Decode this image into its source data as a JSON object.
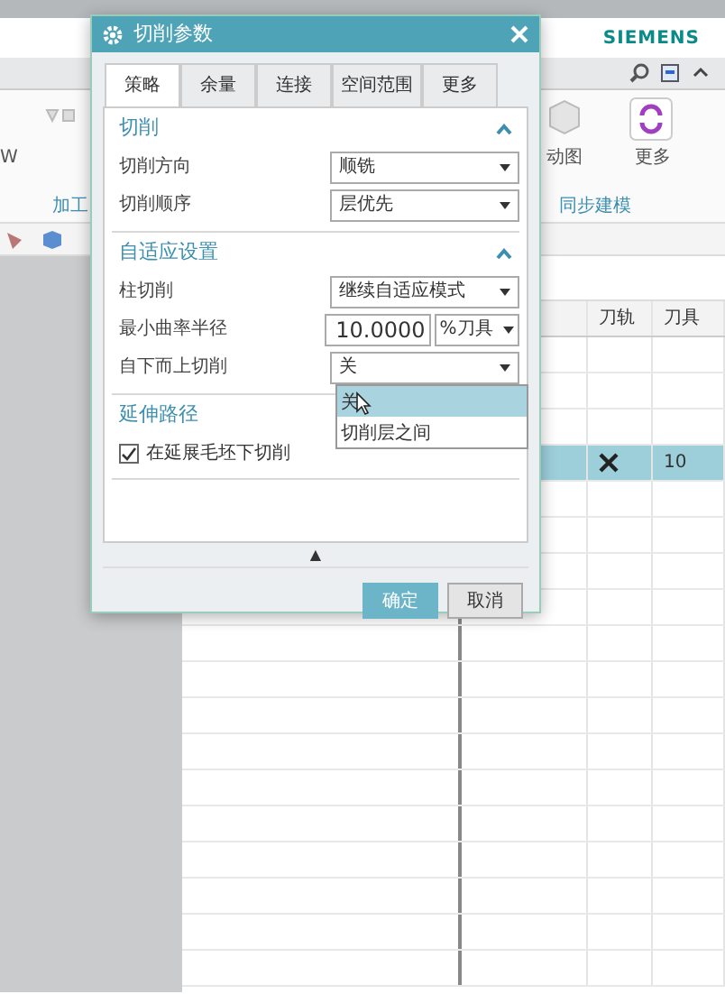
{
  "app": {
    "brand": "SIEMENS",
    "ribbon_labels": [
      {
        "text": "W"
      },
      {
        "text": "加工"
      },
      {
        "text": "动图"
      },
      {
        "text": "更多"
      },
      {
        "text": "同步建模"
      }
    ]
  },
  "table": {
    "columns": [
      "刀轨",
      "刀具"
    ],
    "rows": [
      {
        "selected": false
      },
      {
        "selected": false
      },
      {
        "selected": false
      },
      {
        "selected": true,
        "path_flag": true,
        "tool": "10"
      },
      {
        "selected": false
      },
      {
        "selected": false
      },
      {
        "selected": false
      },
      {
        "selected": false
      },
      {
        "selected": false
      },
      {
        "selected": false
      },
      {
        "selected": false
      },
      {
        "selected": false
      },
      {
        "selected": false
      },
      {
        "selected": false
      },
      {
        "selected": false
      },
      {
        "selected": false
      },
      {
        "selected": false
      },
      {
        "selected": false
      }
    ]
  },
  "dialog": {
    "title": "切削参数",
    "tabs": [
      {
        "label": "策略",
        "selected": true
      },
      {
        "label": "余量",
        "selected": false
      },
      {
        "label": "连接",
        "selected": false
      },
      {
        "label": "空间范围",
        "selected": false
      },
      {
        "label": "更多",
        "selected": false
      }
    ],
    "sections": [
      {
        "title": "切削",
        "expanded": true,
        "rows": [
          {
            "kind": "select",
            "label": "切削方向",
            "value": "顺铣"
          },
          {
            "kind": "select",
            "label": "切削顺序",
            "value": "层优先"
          }
        ]
      },
      {
        "title": "自适应设置",
        "expanded": true,
        "rows": [
          {
            "kind": "select",
            "label": "柱切削",
            "value": "继续自适应模式"
          },
          {
            "kind": "number",
            "label": "最小曲率半径",
            "value": "10.0000",
            "unit": "%刀具"
          },
          {
            "kind": "select",
            "label": "自下而上切削",
            "value": "关",
            "open": true,
            "options": [
              {
                "label": "关",
                "selected": true
              },
              {
                "label": "切削层之间",
                "selected": false
              }
            ]
          }
        ]
      },
      {
        "title": "延伸路径",
        "rows": [
          {
            "kind": "checkbox",
            "label": "在延展毛坯下切削",
            "checked": true
          }
        ]
      }
    ],
    "more_toggle": "▲",
    "buttons": [
      {
        "label": "确定",
        "kind": "primary"
      },
      {
        "label": "取消",
        "kind": "secondary"
      }
    ]
  }
}
